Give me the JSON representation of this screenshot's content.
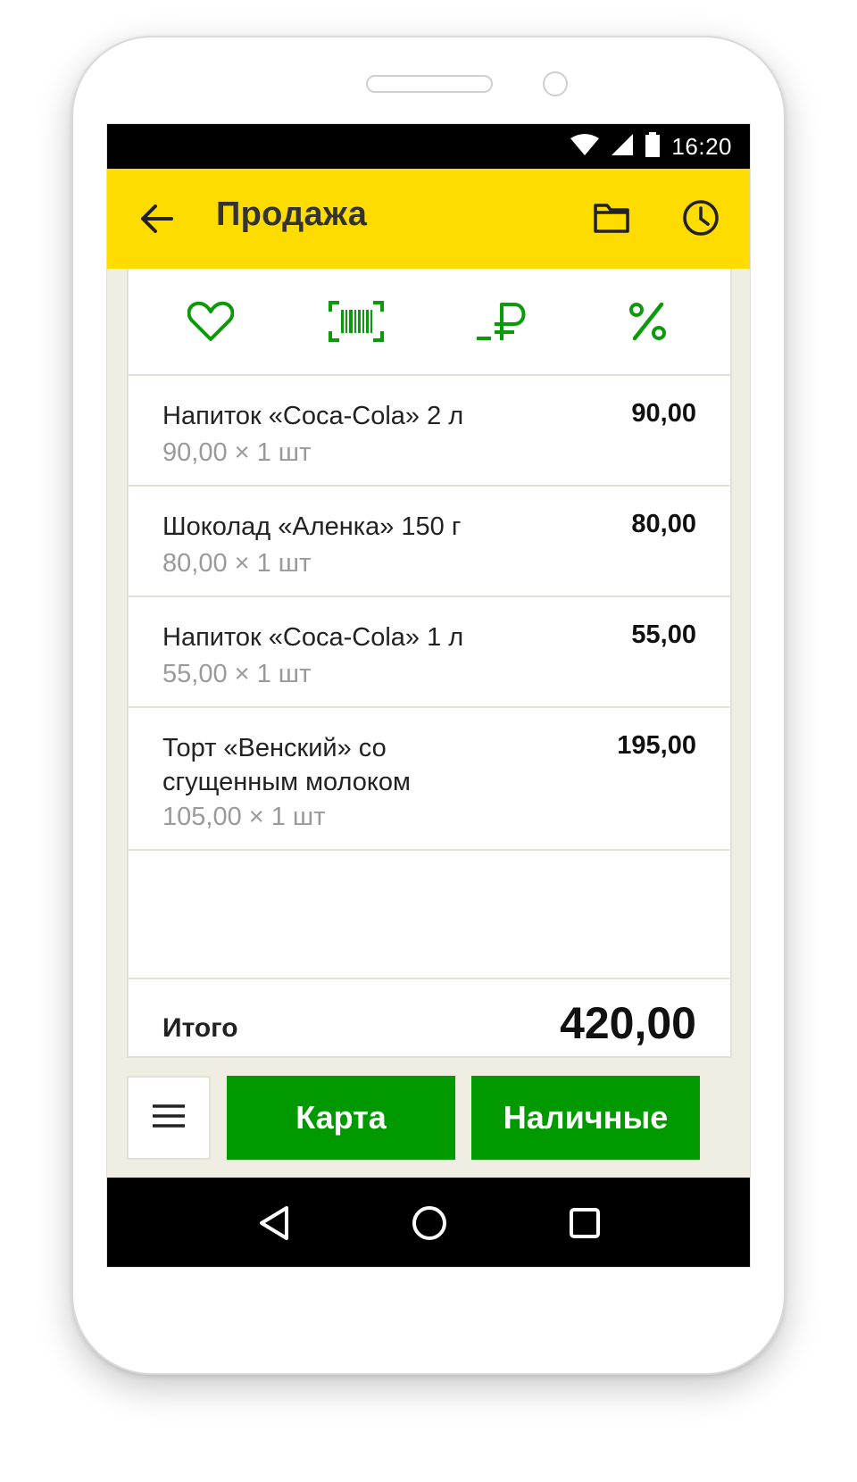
{
  "status_bar": {
    "time": "16:20",
    "icons": [
      "wifi-icon",
      "signal-icon",
      "battery-icon"
    ]
  },
  "app_bar": {
    "title": "Продажа",
    "icons": [
      "back-arrow-icon",
      "folder-icon",
      "clock-icon"
    ]
  },
  "toolbar": {
    "icons": [
      "heart-icon",
      "barcode-icon",
      "ruble-icon",
      "percent-icon"
    ],
    "accent_color": "#009a00"
  },
  "items": [
    {
      "name": "Напиток «Coca-Cola» 2 л",
      "qty": "90,00 × 1 шт",
      "sum": "90,00"
    },
    {
      "name": "Шоколад «Аленка» 150 г",
      "qty": "80,00 × 1 шт",
      "sum": "80,00"
    },
    {
      "name": "Напиток «Coca-Cola» 1 л",
      "qty": "55,00 × 1 шт",
      "sum": "55,00"
    },
    {
      "name": "Торт «Венский» со сгущенным молоком",
      "qty": "105,00 × 1 шт",
      "sum": "195,00"
    }
  ],
  "total": {
    "label": "Итого",
    "value": "420,00"
  },
  "actions": {
    "menu_icon": "hamburger-menu-icon",
    "card_label": "Карта",
    "cash_label": "Наличные",
    "button_color": "#009a00"
  },
  "nav_bar": {
    "icons": [
      "back-triangle-icon",
      "home-circle-icon",
      "recents-square-icon"
    ]
  },
  "colors": {
    "app_bar": "#ffdc00",
    "background": "#f0ede3",
    "system_bars": "#000000"
  }
}
